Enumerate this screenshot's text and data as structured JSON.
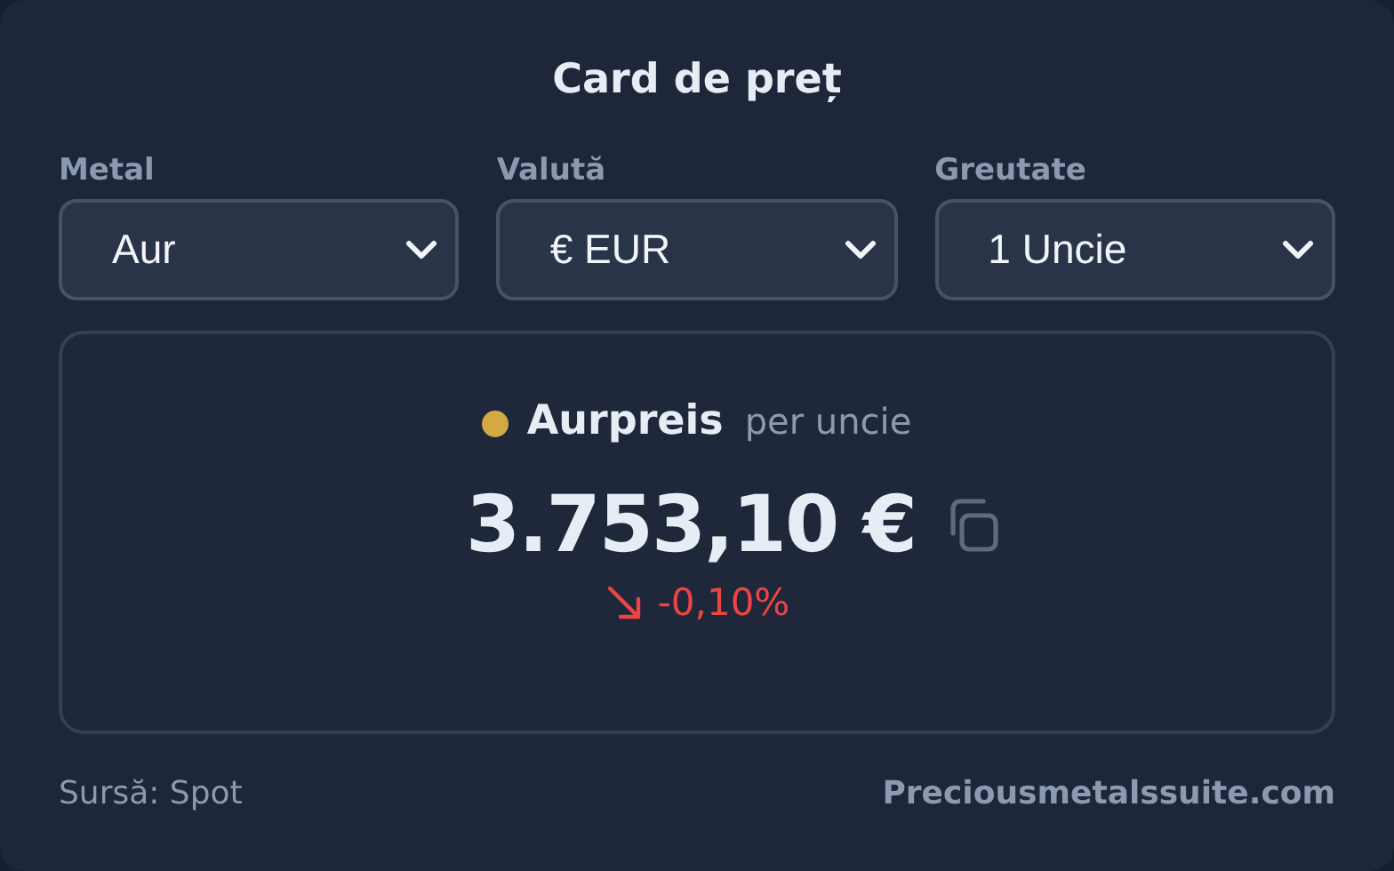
{
  "title": "Card de preț",
  "selects": [
    {
      "label": "Metal",
      "value": "Aur"
    },
    {
      "label": "Valută",
      "value": "€ EUR"
    },
    {
      "label": "Greutate",
      "value": "1 Uncie"
    }
  ],
  "quote": {
    "name": "Aurpreis",
    "unit": "per uncie",
    "price": "3.753,10 €",
    "kind": "down",
    "change": "-0,10%"
  },
  "footer": {
    "source": "Sursă: Spot",
    "link": "Preciousmetalssuite.com"
  }
}
